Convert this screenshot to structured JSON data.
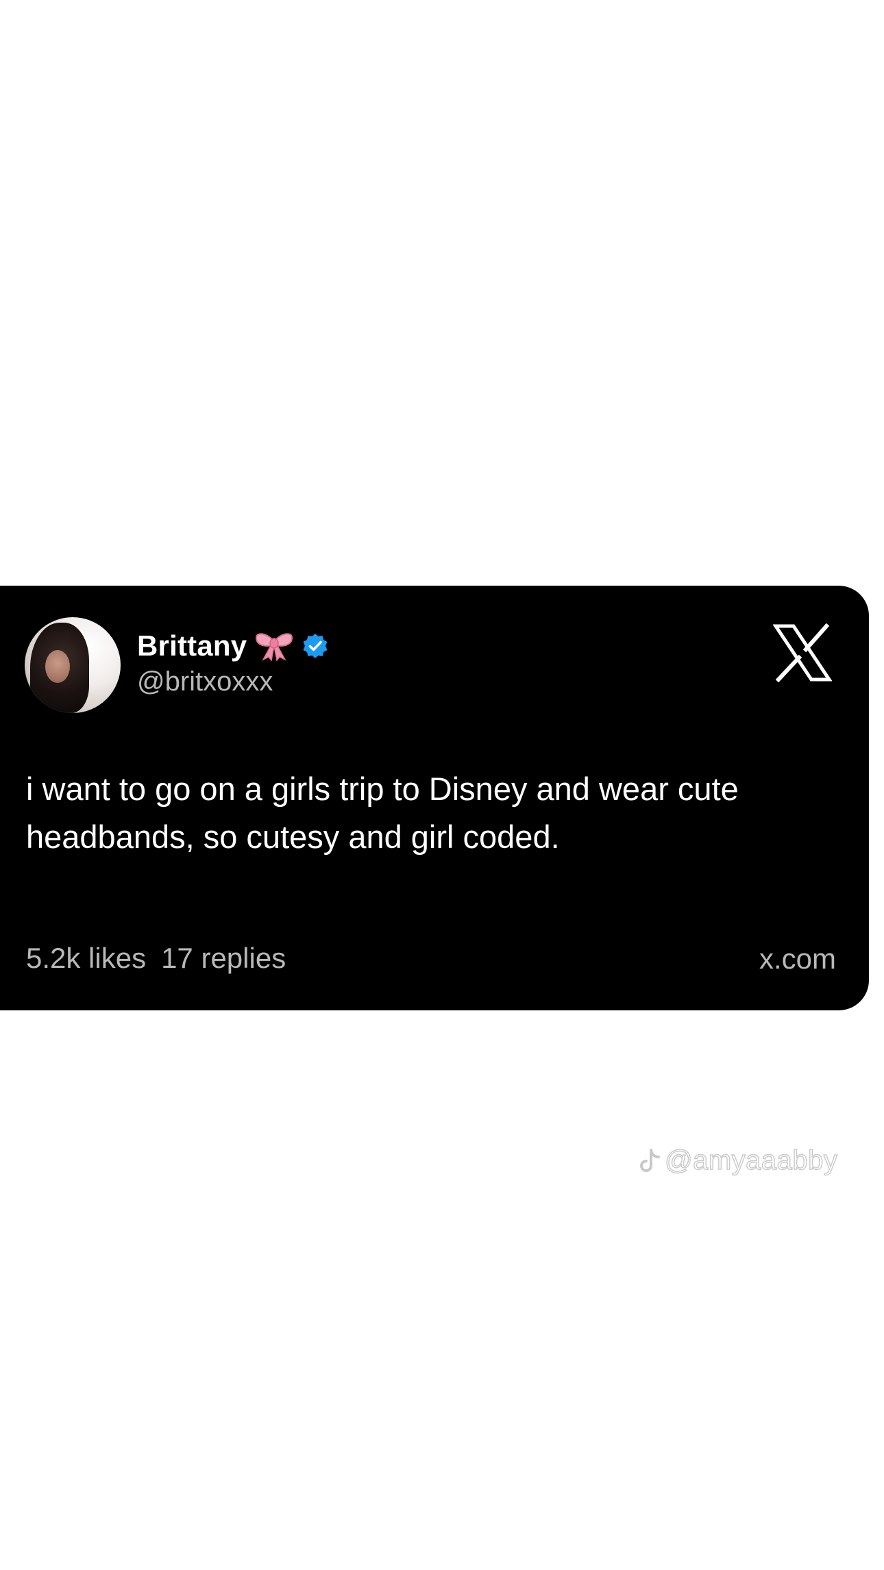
{
  "post": {
    "display_name": "Brittany",
    "handle": "@britxoxxx",
    "text": "i want to go on a girls trip to Disney and wear cute headbands, so cutesy and girl coded.",
    "likes": "5.2k likes",
    "replies": "17 replies",
    "source": "x.com",
    "icons": {
      "name_emoji": "bow-icon",
      "badge": "verified-icon",
      "platform": "x-logo-icon"
    }
  },
  "watermark": {
    "text": "@amyaaabby",
    "icon": "tiktok-icon"
  },
  "colors": {
    "page_background": "#ffffff",
    "card_background": "#000000",
    "primary_text": "#ffffff",
    "secondary_text": "#b8b8b8",
    "verified_blue": "#1d9bf0",
    "bow_pink": "#f4a3bc"
  }
}
